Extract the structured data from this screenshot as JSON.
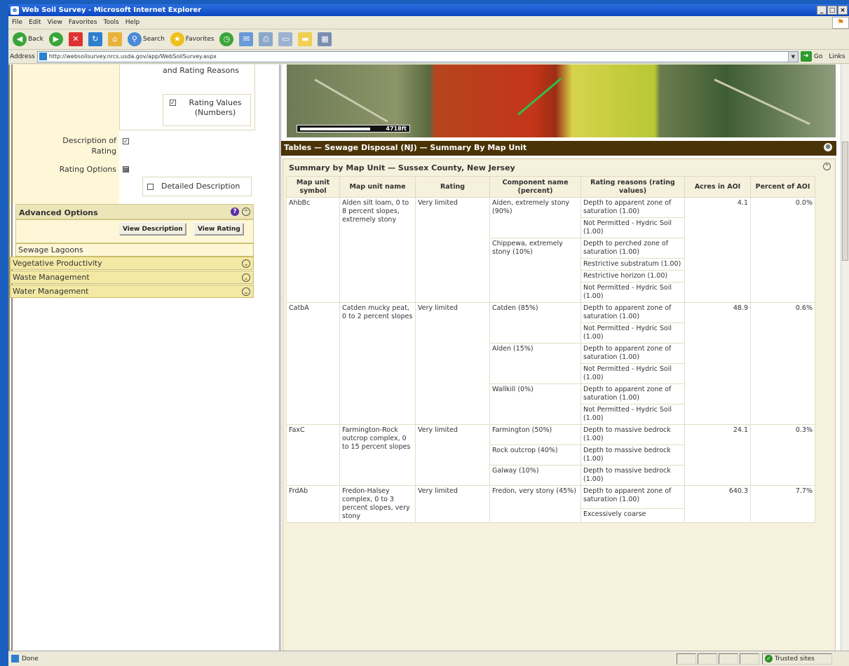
{
  "window": {
    "title": "Web Soil Survey - Microsoft Internet Explorer"
  },
  "menu": [
    "File",
    "Edit",
    "View",
    "Favorites",
    "Tools",
    "Help"
  ],
  "toolbar": {
    "back": "Back",
    "search": "Search",
    "favorites": "Favorites"
  },
  "address": {
    "label": "Address",
    "url": "http://websoilsurvey.nrcs.usda.gov/app/WebSoilSurvey.aspx",
    "go": "Go",
    "links": "Links"
  },
  "left": {
    "rating_reasons_text": "and Rating Reasons",
    "rating_values_label": "Rating Values (Numbers)",
    "description_of_rating": "Description of Rating",
    "rating_options": "Rating Options",
    "detailed_description": "Detailed Description",
    "advanced_options": "Advanced Options",
    "view_description": "View Description",
    "view_rating": "View Rating",
    "sewage_lagoons": "Sewage Lagoons",
    "panels": [
      "Vegetative Productivity",
      "Waste Management",
      "Water Management"
    ]
  },
  "map": {
    "scale_label": "4718ft"
  },
  "table_header": "Tables — Sewage Disposal (NJ) — Summary By Map Unit",
  "summary": {
    "title": "Summary by Map Unit — Sussex County, New Jersey",
    "columns": [
      "Map unit symbol",
      "Map unit name",
      "Rating",
      "Component name (percent)",
      "Rating reasons (rating values)",
      "Acres in AOI",
      "Percent of AOI"
    ],
    "r1": {
      "sym": "AhbBc",
      "name": "Alden silt loam, 0 to 8 percent slopes, extremely stony",
      "rating": "Very limited",
      "acres": "4.1",
      "pct": "0.0%",
      "c1": "Alden, extremely stony (90%)",
      "c2": "Chippewa, extremely stony (10%)",
      "r": [
        "Depth to apparent zone of saturation (1.00)",
        "Not Permitted - Hydric Soil (1.00)",
        "Depth to perched zone of saturation (1.00)",
        "Restrictive substratum (1.00)",
        "Restrictive horizon (1.00)",
        "Not Permitted - Hydric Soil (1.00)"
      ]
    },
    "r2": {
      "sym": "CatbA",
      "name": "Catden mucky peat, 0 to 2 percent slopes",
      "rating": "Very limited",
      "acres": "48.9",
      "pct": "0.6%",
      "c1": "Catden (85%)",
      "c2": "Alden (15%)",
      "c3": "Wallkill (0%)",
      "r": [
        "Depth to apparent zone of saturation (1.00)",
        "Not Permitted - Hydric Soil (1.00)",
        "Depth to apparent zone of saturation (1.00)",
        "Not Permitted - Hydric Soil (1.00)",
        "Depth to apparent zone of saturation (1.00)",
        "Not Permitted - Hydric Soil (1.00)"
      ]
    },
    "r3": {
      "sym": "FaxC",
      "name": "Farmington-Rock outcrop complex, 0 to 15 percent slopes",
      "rating": "Very limited",
      "acres": "24.1",
      "pct": "0.3%",
      "c1": "Farmington (50%)",
      "c2": "Rock outcrop (40%)",
      "c3": "Galway (10%)",
      "r": [
        "Depth to massive bedrock (1.00)",
        "Depth to massive bedrock (1.00)",
        "Depth to massive bedrock (1.00)"
      ]
    },
    "r4": {
      "sym": "FrdAb",
      "name": "Fredon-Halsey complex, 0 to 3 percent slopes, very stony",
      "rating": "Very limited",
      "acres": "640.3",
      "pct": "7.7%",
      "c1": "Fredon, very stony (45%)",
      "r": [
        "Depth to apparent zone of saturation (1.00)",
        "Excessively coarse"
      ]
    }
  },
  "status": {
    "done": "Done",
    "zone": "Trusted sites"
  }
}
